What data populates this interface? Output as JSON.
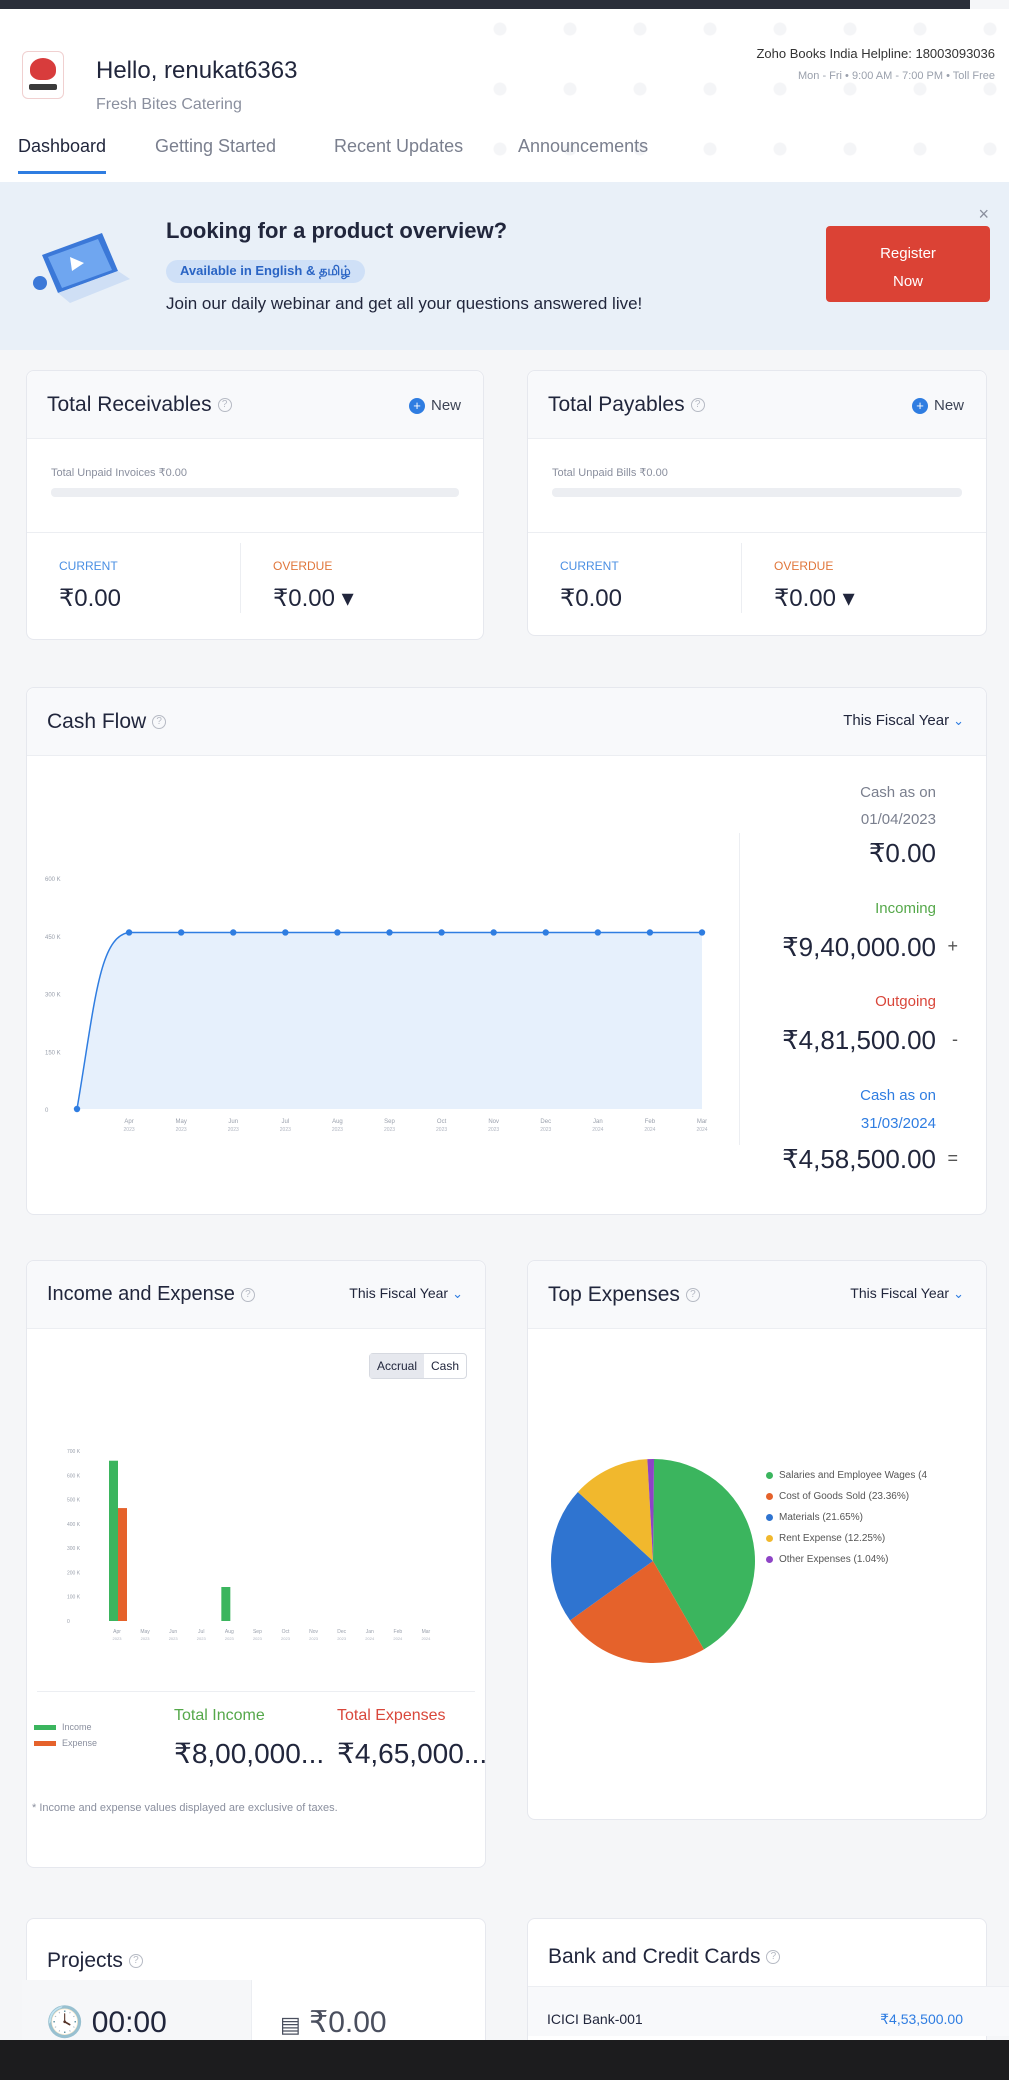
{
  "header": {
    "greeting": "Hello, renukat6363",
    "org": "Fresh Bites Catering",
    "helpline": "Zoho Books India Helpline: 18003093036",
    "hours": "Mon - Fri • 9:00 AM - 7:00 PM • Toll Free"
  },
  "tabs": [
    {
      "label": "Dashboard",
      "active": true
    },
    {
      "label": "Getting Started",
      "active": false
    },
    {
      "label": "Recent Updates",
      "active": false
    },
    {
      "label": "Announcements",
      "active": false
    }
  ],
  "banner": {
    "title": "Looking for a product overview?",
    "pill": "Available in English & தமிழ்",
    "subtitle": "Join our daily webinar and get all your questions answered live!",
    "close": "×",
    "button_line1": "Register",
    "button_line2": "Now"
  },
  "receivables": {
    "title": "Total Receivables",
    "new_label": "New",
    "unpaid": "Total Unpaid Invoices ₹0.00",
    "progress": 0,
    "current_label": "CURRENT",
    "current_value": "₹0.00",
    "overdue_label": "OVERDUE",
    "overdue_value": "₹0.00 ▾"
  },
  "payables": {
    "title": "Total Payables",
    "new_label": "New",
    "unpaid": "Total Unpaid Bills ₹0.00",
    "progress": 0,
    "current_label": "CURRENT",
    "current_value": "₹0.00",
    "overdue_label": "OVERDUE",
    "overdue_value": "₹0.00 ▾"
  },
  "cashflow": {
    "title": "Cash Flow",
    "period": "This Fiscal Year",
    "start_label_1": "Cash as on",
    "start_label_2": "01/04/2023",
    "start_value": "₹0.00",
    "incoming_label": "Incoming",
    "incoming_value": "₹9,40,000.00",
    "incoming_sign": "+",
    "outgoing_label": "Outgoing",
    "outgoing_value": "₹4,81,500.00",
    "outgoing_sign": "-",
    "end_label_1": "Cash as on",
    "end_label_2": "31/03/2024",
    "end_value": "₹4,58,500.00",
    "end_sign": "="
  },
  "income_expense": {
    "title": "Income and Expense",
    "period": "This Fiscal Year",
    "toggle_accrual": "Accrual",
    "toggle_cash": "Cash",
    "legend_income": "Income",
    "legend_expense": "Expense",
    "total_income_label": "Total Income",
    "total_income_value": "₹8,00,000...",
    "total_expense_label": "Total Expenses",
    "total_expense_value": "₹4,65,000...",
    "note": "* Income and expense values displayed are exclusive of taxes."
  },
  "top_expenses": {
    "title": "Top Expenses",
    "period": "This Fiscal Year"
  },
  "projects": {
    "title": "Projects",
    "time": "00:00",
    "amount": "₹0.00"
  },
  "bank": {
    "title": "Bank and Credit Cards",
    "account": "ICICI Bank-001",
    "amount": "₹4,53,500.00"
  },
  "colors": {
    "accent": "#2f7de1",
    "register": "#db4235",
    "income": "#3bb55e",
    "expense": "#e5622b"
  },
  "chart_data": [
    {
      "type": "area",
      "title": "Cash Flow",
      "categories": [
        "Apr 2023",
        "May 2023",
        "Jun 2023",
        "Jul 2023",
        "Aug 2023",
        "Sep 2023",
        "Oct 2023",
        "Nov 2023",
        "Dec 2023",
        "Jan 2024",
        "Feb 2024",
        "Mar 2024"
      ],
      "y_ticks": [
        "0",
        "150 K",
        "300 K",
        "450 K",
        "600 K"
      ],
      "values": [
        0,
        458500,
        458500,
        458500,
        458500,
        458500,
        458500,
        458500,
        458500,
        458500,
        458500,
        458500,
        458500
      ],
      "ylim": [
        0,
        600000
      ]
    },
    {
      "type": "bar",
      "title": "Income and Expense",
      "categories": [
        "Apr 2023",
        "May 2023",
        "Jun 2023",
        "Jul 2023",
        "Aug 2023",
        "Sep 2023",
        "Oct 2023",
        "Nov 2023",
        "Dec 2023",
        "Jan 2024",
        "Feb 2024",
        "Mar 2024"
      ],
      "y_ticks": [
        "0",
        "100 K",
        "200 K",
        "300 K",
        "400 K",
        "500 K",
        "600 K",
        "700 K"
      ],
      "series": [
        {
          "name": "Income",
          "values": [
            660000,
            0,
            0,
            0,
            140000,
            0,
            0,
            0,
            0,
            0,
            0,
            0
          ]
        },
        {
          "name": "Expense",
          "values": [
            465000,
            0,
            0,
            0,
            0,
            0,
            0,
            0,
            0,
            0,
            0,
            0
          ]
        }
      ],
      "ylim": [
        0,
        700000
      ]
    },
    {
      "type": "pie",
      "title": "Top Expenses",
      "slices": [
        {
          "label": "Salaries and Employee Wages (4",
          "value": 41.39,
          "color": "#3bb55e"
        },
        {
          "label": "Cost of Goods Sold (23.36%)",
          "value": 23.36,
          "color": "#e5622b"
        },
        {
          "label": "Materials (21.65%)",
          "value": 21.65,
          "color": "#2f74d0"
        },
        {
          "label": "Rent Expense (12.25%)",
          "value": 12.25,
          "color": "#f1b82d"
        },
        {
          "label": "Other Expenses (1.04%)",
          "value": 1.04,
          "color": "#8e44c6"
        }
      ]
    }
  ]
}
